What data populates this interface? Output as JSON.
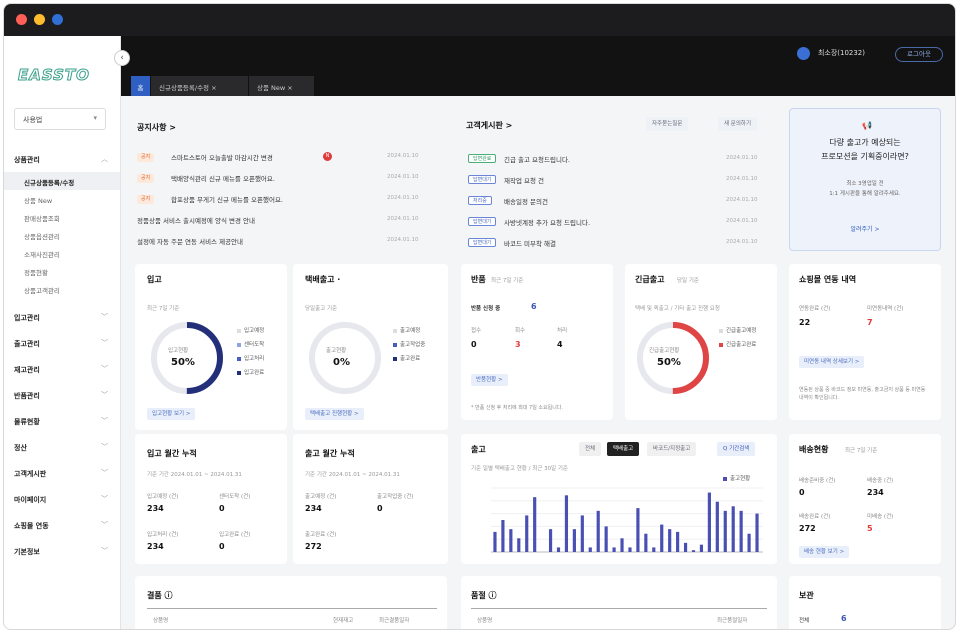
{
  "window": {
    "controls": [
      "close",
      "minimize",
      "maximize"
    ],
    "control_colors": [
      "#ff5f57",
      "#febc2e",
      "#2f6fd6"
    ]
  },
  "sidebar": {
    "logo": "EASSTO",
    "collapse_icon": "chevron-left-icon",
    "store_select": "사용법",
    "groups": [
      {
        "label": "상품관리",
        "children": [
          "신규상품등록/수정",
          "상품 New",
          "판매상품조회",
          "상품옵션관리",
          "소재사진관리",
          "정품현황",
          "상품고객관리"
        ],
        "active_child": 0
      },
      {
        "label": "입고관리"
      },
      {
        "label": "출고관리"
      },
      {
        "label": "재고관리"
      },
      {
        "label": "반품관리"
      },
      {
        "label": "물류현황"
      },
      {
        "label": "정산"
      },
      {
        "label": "고객게시판"
      },
      {
        "label": "마이페이지"
      },
      {
        "label": "쇼핑몰 연동"
      },
      {
        "label": "기본정보"
      }
    ]
  },
  "header": {
    "user_name": "최소장(10232)",
    "logout": "로그아웃",
    "tabs": [
      {
        "label": "홈"
      },
      {
        "label": "신규상품등록/수정 ×"
      },
      {
        "label": "상품 New ×"
      }
    ]
  },
  "notice": {
    "title": "공지사항 >",
    "items": [
      {
        "badge": "공지",
        "text": "스마트스토어 오늘출발 마감시간 변경",
        "date": "2024.01.10",
        "new": "N"
      },
      {
        "badge": "공지",
        "text": "택배양식관리 신규 메뉴를 오픈했어요.",
        "date": "2024.01.10"
      },
      {
        "badge": "공지",
        "text": "합포상품 무게기 신규 메뉴를 오픈했어요.",
        "date": "2024.01.10"
      },
      {
        "badge": "",
        "text": "정품상품 서비스 출시예정에 양식 변경 안내",
        "date": "2024.01.10"
      },
      {
        "badge": "",
        "text": "설정에 자동 주문 연동 서비스 제공안내",
        "date": "2024.01.10"
      }
    ]
  },
  "board": {
    "title": "고객게시판 >",
    "btn_faq": "자주묻는질문",
    "btn_ask": "새 문의하기",
    "items": [
      {
        "badge": "답변완료",
        "text": "긴급 출고 요청드립니다.",
        "date": "2024.01.10"
      },
      {
        "badge": "답변대기",
        "text": "재작업 요청 건",
        "date": "2024.01.10"
      },
      {
        "badge": "처리중",
        "text": "배송일정 문의건",
        "date": "2024.01.10"
      },
      {
        "badge": "답변대기",
        "text": "사방넷계정 추가 요청 드립니다.",
        "date": "2024.01.10"
      },
      {
        "badge": "답변대기",
        "text": "바코드 미부착 해결",
        "date": "2024.01.10"
      }
    ]
  },
  "promo": {
    "icon": "megaphone-icon",
    "headline1": "다량 출고가 예상되는",
    "headline2": "프로모션을 기획중이라면?",
    "desc1": "최소 3영업일 전",
    "desc2": "1:1 게시판을 통해 알려주세요.",
    "link": "알려주기 >"
  },
  "inbound": {
    "title": "입고",
    "sub": "최근 7일 기준",
    "center_label": "입고현황",
    "center_value": "50%",
    "progress": 0.5,
    "legend": [
      "입고예정",
      "센터도착",
      "입고처리",
      "입고완료"
    ],
    "button": "입고현황 보기 >"
  },
  "parcel": {
    "title": "택배출고 ·",
    "sub": "당일출고 기준",
    "center_label": "출고현황",
    "center_value": "0%",
    "progress": 0.0,
    "legend": [
      "출고예정",
      "출고작업중",
      "출고완료"
    ],
    "button": "택배출고 진행현황 >"
  },
  "returns": {
    "title": "반품",
    "sub": "최근 7일 기준",
    "pending_label": "반품 신청 중",
    "pending_value": "6",
    "cols": [
      {
        "label": "접수",
        "value": "0"
      },
      {
        "label": "회수",
        "value": "3",
        "red": true
      },
      {
        "label": "처리",
        "value": "4"
      }
    ],
    "button": "반품현황 >",
    "note": "* 반품 신청 후 처리에 최대 7일 소요됩니다."
  },
  "urgent": {
    "title": "긴급출고",
    "sub": "당일 기준",
    "desc": "택배 및 퀵출고 / 기타 출고 진행 요청",
    "center_label": "긴급출고현황",
    "center_value": "50%",
    "progress": 0.5,
    "legend": [
      "긴급출고예정",
      "긴급출고완료"
    ]
  },
  "mall": {
    "title": "쇼핑몰 연동 내역",
    "c1_label": "연동완료 (건)",
    "c1_value": "22",
    "c2_label": "미연동내역 (건)",
    "c2_value": "7",
    "button": "미연동 내역 상세보기 >",
    "note": "연동된 상품 중 바코드 정보 미연동, 출고금지 상품 등 미연동 내역이 확인됩니다."
  },
  "in_monthly": {
    "title": "입고 월간 누적",
    "sub": "기준 기간 2024.01.01 ~ 2024.01.31",
    "cells": [
      {
        "label": "입고예정 (건)",
        "value": "234"
      },
      {
        "label": "센터도착 (건)",
        "value": "0"
      },
      {
        "label": "입고처리 (건)",
        "value": "234"
      },
      {
        "label": "입고완료 (건)",
        "value": "0"
      }
    ]
  },
  "out_monthly": {
    "title": "출고 월간 누적",
    "sub": "기준 기간 2024.01.01 ~ 2024.01.31",
    "cells": [
      {
        "label": "출고예정 (건)",
        "value": "234"
      },
      {
        "label": "출고작업중 (건)",
        "value": "0"
      },
      {
        "label": "출고완료 (건)",
        "value": "272"
      }
    ]
  },
  "outbound_chart": {
    "title": "출고",
    "sub": "기준 일별 택배출고 현황 / 최근 30일 기준",
    "filters": [
      "전체",
      "택배출고",
      "바코드/지정출고"
    ],
    "active_filter": 1,
    "search_btn": "Q 기간검색",
    "legend": "출고현황",
    "series_color": "#4a4fb3"
  },
  "chart_data": {
    "type": "bar",
    "values": [
      22,
      35,
      25,
      15,
      40,
      60,
      0,
      25,
      5,
      62,
      25,
      40,
      5,
      45,
      28,
      5,
      15,
      5,
      48,
      20,
      5,
      30,
      25,
      22,
      10,
      2,
      8,
      65,
      55,
      45,
      50,
      45,
      20,
      42
    ],
    "ylim": [
      0,
      70
    ]
  },
  "delivery": {
    "title": "배송현황",
    "sub": "최근 7일 기준",
    "cells": [
      {
        "label": "배송준비중 (건)",
        "value": "0"
      },
      {
        "label": "배송중 (건)",
        "value": "234"
      },
      {
        "label": "배송완료 (건)",
        "value": "272"
      },
      {
        "label": "미배송 (건)",
        "value": "5",
        "red": true
      }
    ],
    "button": "배송 현황 보기 >"
  },
  "bottom": {
    "left_title": "결품 ⓘ",
    "left_cols": [
      "상품명",
      "현재재고",
      "최근결품일자"
    ],
    "mid_title": "품절 ⓘ",
    "mid_cols": [
      "상품명",
      "최근품절일자"
    ],
    "right_title": "보관",
    "right_label": "전체",
    "right_value": "6"
  }
}
